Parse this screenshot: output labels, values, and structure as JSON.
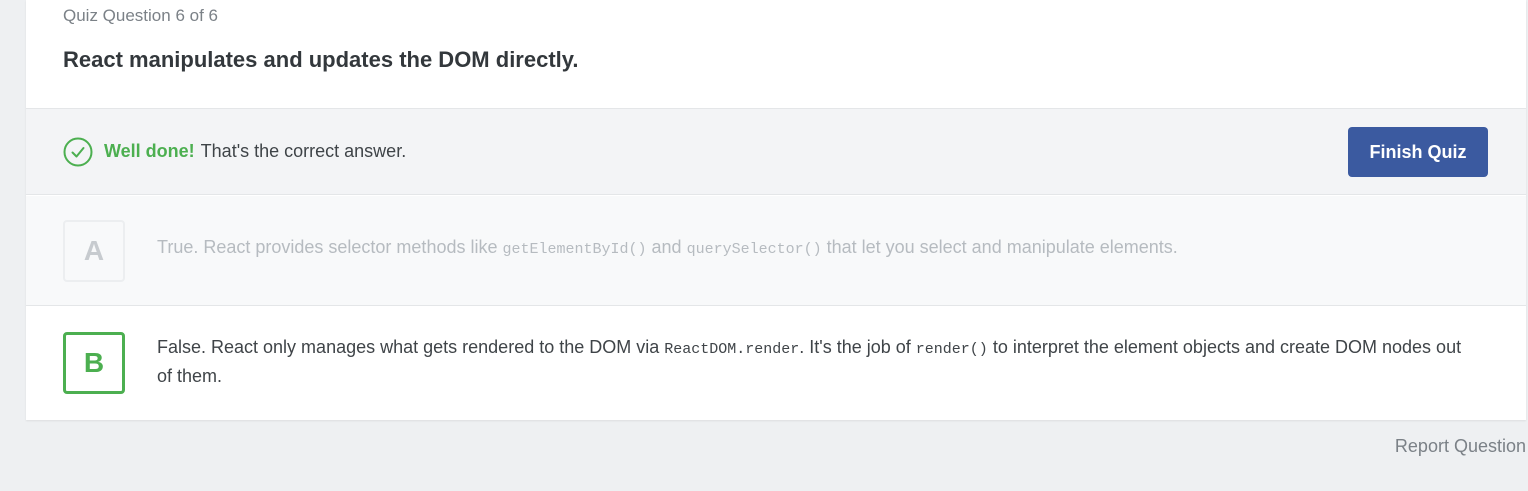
{
  "question": {
    "counter": "Quiz Question 6 of 6",
    "title": "React manipulates and updates the DOM directly."
  },
  "feedback": {
    "icon": "check-circle-icon",
    "strong": "Well done!",
    "message": "That's the correct answer.",
    "finish_label": "Finish Quiz"
  },
  "answers": [
    {
      "letter": "A",
      "text_1": "True. React provides selector methods like ",
      "code_1": "getElementById()",
      "text_2": " and ",
      "code_2": "querySelector()",
      "text_3": " that let you select and manipulate elements."
    },
    {
      "letter": "B",
      "text_1": "False. React only manages what gets rendered to the DOM via ",
      "code_1": "ReactDOM.render",
      "text_2": ". It's the job of ",
      "code_2": "render()",
      "text_3": " to interpret the element objects and create DOM nodes out of them."
    }
  ],
  "report_label": "Report Question",
  "colors": {
    "accent_green": "#4caf50",
    "button_blue": "#3b5aa0",
    "page_bg": "#eef0f2"
  }
}
